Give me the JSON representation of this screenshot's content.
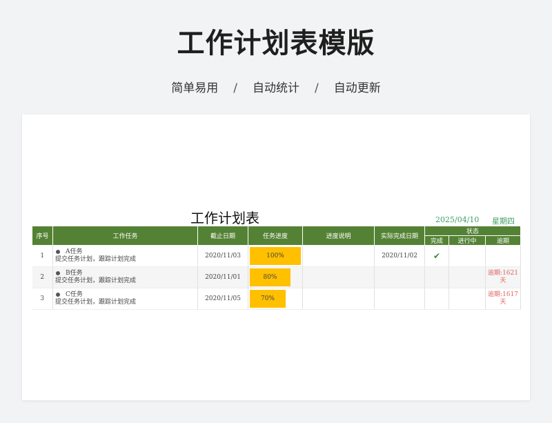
{
  "banner": {
    "title": "工作计划表模版",
    "features": [
      "简单易用",
      "自动统计",
      "自动更新"
    ],
    "separator": "/"
  },
  "sheet": {
    "title": "工作计划表",
    "date": "2025/04/10",
    "weekday": "星期四",
    "headers": {
      "index": "序号",
      "task": "工作任务",
      "deadline": "截止日期",
      "progress": "任务进度",
      "progress_note": "进度说明",
      "actual_done": "实际完成日期",
      "status": "状态",
      "status_done": "完成",
      "status_in_progress": "进行中",
      "status_overdue": "逾期"
    },
    "rows": [
      {
        "index": "1",
        "task_name": "A任务",
        "task_desc": "提交任务计划，跟踪计划完成",
        "deadline": "2020/11/03",
        "progress": 1.0,
        "progress_label": "100%",
        "note": "",
        "actual_done": "2020/11/02",
        "done": "✔",
        "in_progress": "",
        "overdue": ""
      },
      {
        "index": "2",
        "task_name": "B任务",
        "task_desc": "提交任务计划，跟踪计划完成",
        "deadline": "2020/11/01",
        "progress": 0.8,
        "progress_label": "80%",
        "note": "",
        "actual_done": "",
        "done": "",
        "in_progress": "",
        "overdue": "逾期:1621天"
      },
      {
        "index": "3",
        "task_name": "C任务",
        "task_desc": "提交任务计划，跟踪计划完成",
        "deadline": "2020/11/05",
        "progress": 0.7,
        "progress_label": "70%",
        "note": "",
        "actual_done": "",
        "done": "",
        "in_progress": "",
        "overdue": "逾期:1617天"
      }
    ]
  },
  "colors": {
    "header_green": "#548235",
    "progress_bar": "#ffc000",
    "date_green": "#3f9d63",
    "overdue_red": "#e06060",
    "check_green": "#2e8b3a"
  }
}
